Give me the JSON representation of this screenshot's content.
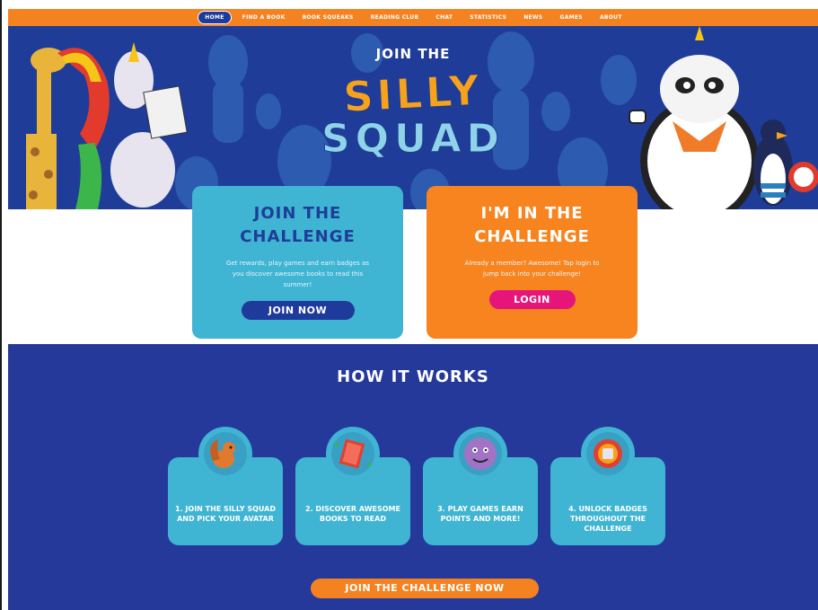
{
  "nav": {
    "items": [
      {
        "label": "HOME",
        "active": true
      },
      {
        "label": "FIND A BOOK"
      },
      {
        "label": "BOOK SQUEAKS"
      },
      {
        "label": "READING CLUB"
      },
      {
        "label": "CHAT"
      },
      {
        "label": "STATISTICS"
      },
      {
        "label": "NEWS"
      },
      {
        "label": "GAMES"
      },
      {
        "label": "ABOUT"
      }
    ]
  },
  "hero": {
    "join_the": "JOIN THE",
    "silly": "SILLY",
    "squad": "SQUAD"
  },
  "join_card": {
    "heading_line1": "JOIN THE",
    "heading_line2": "CHALLENGE",
    "text": "Get rewards, play games and earn badges as you discover awesome books to read this summer!",
    "button": "JOIN NOW"
  },
  "login_card": {
    "heading_line1": "I'M IN THE",
    "heading_line2": "CHALLENGE",
    "text": "Already a member? Awesome! Tap login to jump back into your challenge!",
    "button": "LOGIN"
  },
  "how_it_works": {
    "title": "HOW IT WORKS",
    "steps": [
      {
        "label": "1. JOIN THE SILLY SQUAD AND PICK YOUR AVATAR",
        "icon": "squirrel-icon"
      },
      {
        "label": "2. DISCOVER AWESOME BOOKS TO READ",
        "icon": "book-icon"
      },
      {
        "label": "3. PLAY GAMES EARN POINTS AND MORE!",
        "icon": "monster-face-icon"
      },
      {
        "label": "4. UNLOCK BADGES THROUGHOUT THE CHALLENGE",
        "icon": "badge-icon"
      }
    ],
    "cta": "JOIN THE CHALLENGE NOW"
  },
  "colors": {
    "nav_orange": "#f58220",
    "hero_blue": "#1f3d98",
    "card_cyan": "#3fb4d3",
    "card_orange": "#f7841e",
    "login_pink": "#e5157a",
    "section_blue": "#24399a"
  }
}
